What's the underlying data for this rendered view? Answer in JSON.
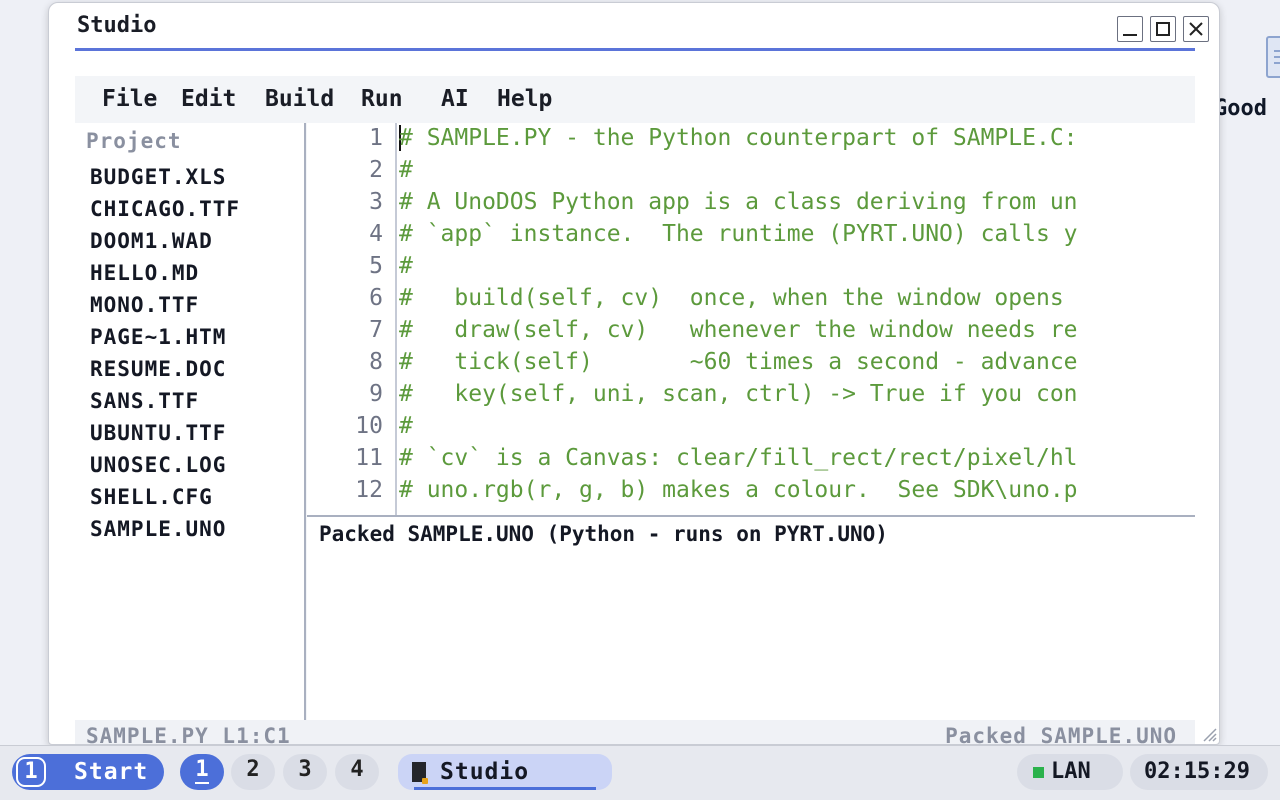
{
  "desktop": {
    "icon_label": "Good"
  },
  "window": {
    "title": "Studio",
    "menu": [
      "File",
      "Edit",
      "Build",
      "Run",
      "AI",
      "Help"
    ],
    "sidebar": {
      "title": "Project",
      "files": [
        "BUDGET.XLS",
        "CHICAGO.TTF",
        "DOOM1.WAD",
        "HELLO.MD",
        "MONO.TTF",
        "PAGE~1.HTM",
        "RESUME.DOC",
        "SANS.TTF",
        "UBUNTU.TTF",
        "UNOSEC.LOG",
        "SHELL.CFG",
        "SAMPLE.UNO"
      ]
    },
    "editor": {
      "lines": [
        {
          "n": "1",
          "text": "# SAMPLE.PY - the Python counterpart of SAMPLE.C:"
        },
        {
          "n": "2",
          "text": "#"
        },
        {
          "n": "3",
          "text": "# A UnoDOS Python app is a class deriving from un"
        },
        {
          "n": "4",
          "text": "# `app` instance.  The runtime (PYRT.UNO) calls y"
        },
        {
          "n": "5",
          "text": "#"
        },
        {
          "n": "6",
          "text": "#   build(self, cv)  once, when the window opens"
        },
        {
          "n": "7",
          "text": "#   draw(self, cv)   whenever the window needs re"
        },
        {
          "n": "8",
          "text": "#   tick(self)       ~60 times a second - advance"
        },
        {
          "n": "9",
          "text": "#   key(self, uni, scan, ctrl) -> True if you con"
        },
        {
          "n": "10",
          "text": "#"
        },
        {
          "n": "11",
          "text": "# `cv` is a Canvas: clear/fill_rect/rect/pixel/hl"
        },
        {
          "n": "12",
          "text": "# uno.rgb(r, g, b) makes a colour.  See SDK\\uno.p"
        }
      ]
    },
    "output": "Packed SAMPLE.UNO (Python - runs on PYRT.UNO)",
    "status": {
      "left": "SAMPLE.PY L1:C1",
      "right": "Packed SAMPLE.UNO"
    }
  },
  "taskbar": {
    "start_number": "1",
    "start_label": "Start",
    "workspaces": [
      "1",
      "2",
      "3",
      "4"
    ],
    "active_workspace": "1",
    "task_label": "Studio",
    "network": "LAN",
    "clock": "02:15:29"
  },
  "colors": {
    "accent": "#4c6fd9",
    "code_comment": "#5c9a3c",
    "status_net": "#2bb24c"
  }
}
